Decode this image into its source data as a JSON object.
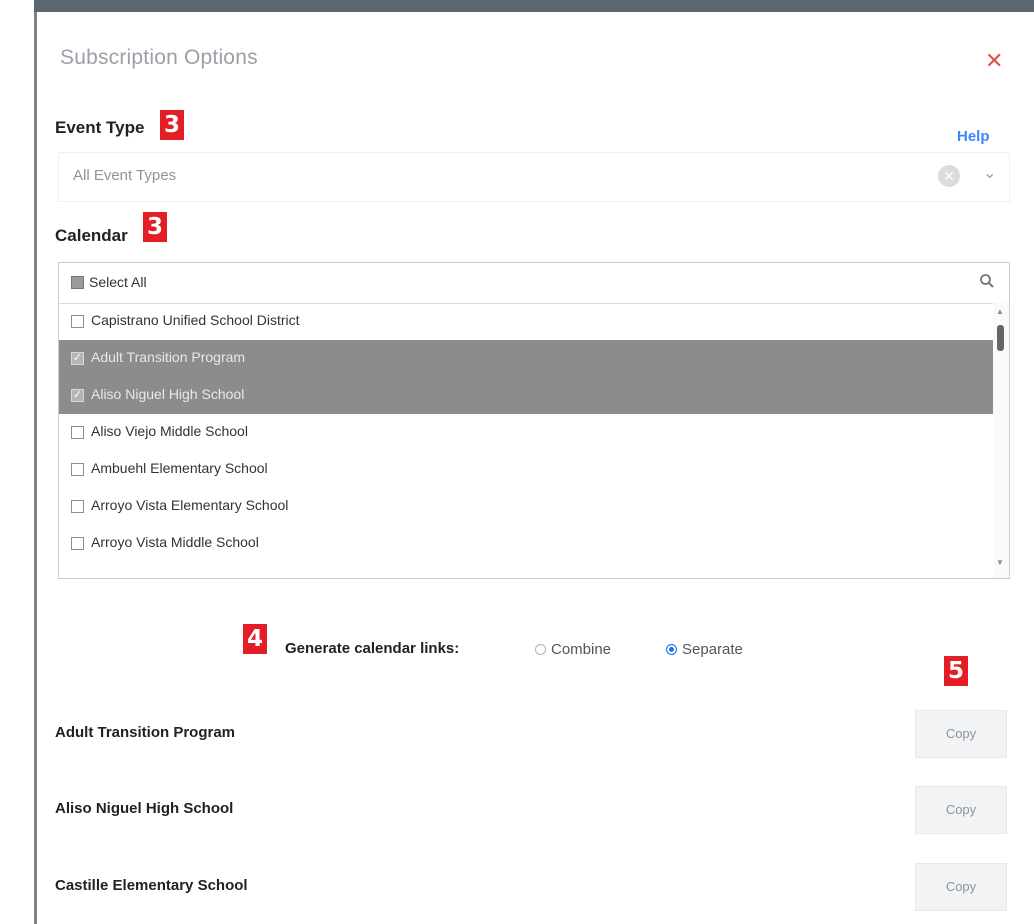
{
  "modal": {
    "title": "Subscription Options",
    "close_icon": "close-icon",
    "help_link": "Help"
  },
  "event_type": {
    "label": "Event Type",
    "badge": "3",
    "value": "All Event Types"
  },
  "calendar": {
    "label": "Calendar",
    "badge": "3",
    "select_all_label": "Select All",
    "items": [
      {
        "label": "Capistrano Unified School District",
        "checked": false
      },
      {
        "label": "Adult Transition Program",
        "checked": true
      },
      {
        "label": "Aliso Niguel High School",
        "checked": true
      },
      {
        "label": "Aliso Viejo Middle School",
        "checked": false
      },
      {
        "label": "Ambuehl Elementary School",
        "checked": false
      },
      {
        "label": "Arroyo Vista Elementary School",
        "checked": false
      },
      {
        "label": "Arroyo Vista Middle School",
        "checked": false
      }
    ]
  },
  "generate": {
    "badge": "4",
    "label": "Generate calendar links:",
    "options": [
      {
        "label": "Combine",
        "selected": false
      },
      {
        "label": "Separate",
        "selected": true
      }
    ]
  },
  "links": {
    "badge": "5",
    "copy_label": "Copy",
    "rows": [
      {
        "label": "Adult Transition Program"
      },
      {
        "label": "Aliso Niguel High School"
      },
      {
        "label": "Castille Elementary School"
      }
    ]
  },
  "colors": {
    "badge": "#e41e26",
    "accent": "#3a86ff",
    "selected_row": "#8c8c8c",
    "close": "#e0524a"
  }
}
